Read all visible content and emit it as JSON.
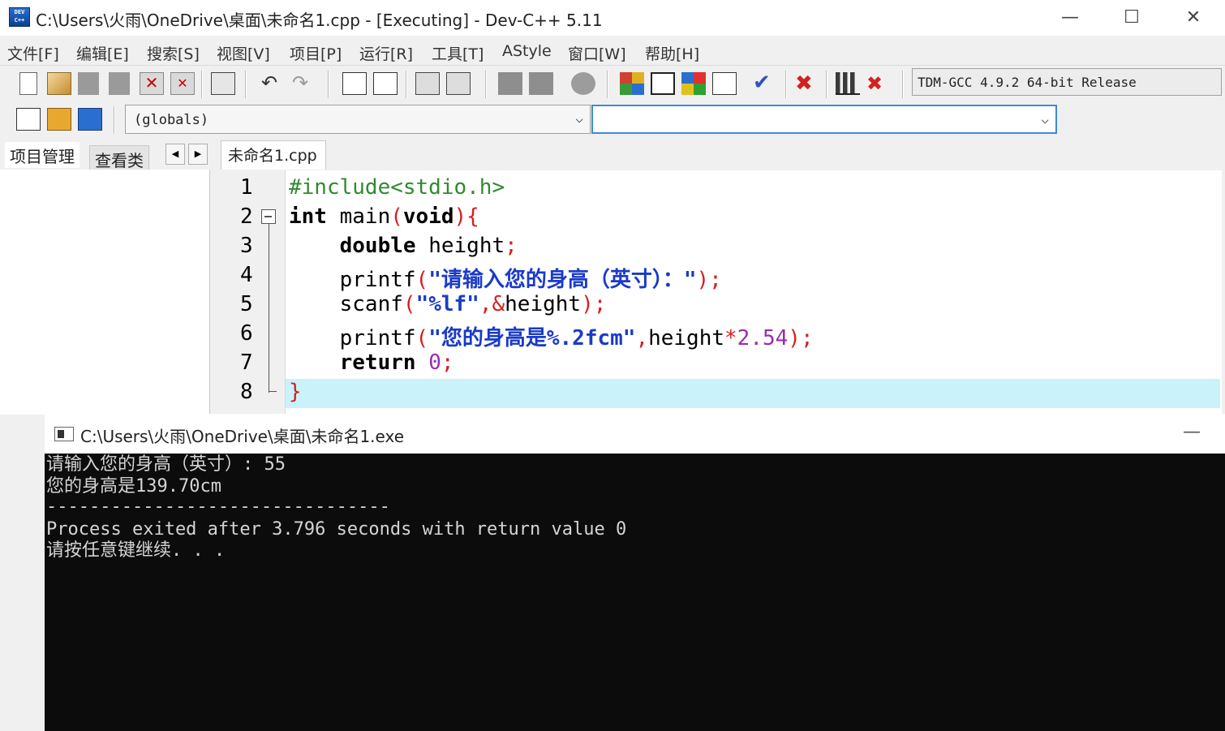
{
  "window": {
    "title": "C:\\Users\\火雨\\OneDrive\\桌面\\未命名1.cpp - [Executing] - Dev-C++ 5.11",
    "icon_label": "DEV C++",
    "min_glyph": "—",
    "max_glyph": "☐",
    "close_glyph": "✕"
  },
  "menu": [
    "文件[F]",
    "编辑[E]",
    "搜索[S]",
    "视图[V]",
    "项目[P]",
    "运行[R]",
    "工具[T]",
    "AStyle",
    "窗口[W]",
    "帮助[H]"
  ],
  "toolbar": {
    "icons": [
      "new-file-icon",
      "open-file-icon",
      "save-icon",
      "save-all-icon",
      "close-icon",
      "close-all-icon",
      "print-icon",
      "undo-icon",
      "redo-icon",
      "find-icon",
      "replace-icon",
      "indent-icon",
      "unindent-icon",
      "bookmark-prev-icon",
      "bookmark-next-icon",
      "toggle-comment-icon",
      "new-project-icon",
      "window-icon",
      "compile-icon",
      "run-icon",
      "check-icon",
      "stop-icon",
      "chart-icon",
      "debug-icon"
    ],
    "compiler": "TDM-GCC 4.9.2 64-bit Release"
  },
  "toolbar2": {
    "globals": "(globals)",
    "function_combo": ""
  },
  "left_panel": {
    "tabs": [
      "项目管理",
      "查看类"
    ],
    "nav_prev": "◀",
    "nav_next": "▶"
  },
  "editor": {
    "tab": "未命名1.cpp",
    "line_numbers": [
      "1",
      "2",
      "3",
      "4",
      "5",
      "6",
      "7",
      "8"
    ],
    "highlight_color": "#c9f2fa"
  },
  "console": {
    "title": "C:\\Users\\火雨\\OneDrive\\桌面\\未命名1.exe",
    "min_glyph": "—",
    "lines": [
      "请输入您的身高（英寸）: 55",
      "您的身高是139.70cm",
      "--------------------------------",
      "Process exited after 3.796 seconds with return value 0",
      "请按任意键继续. . ."
    ]
  },
  "code": {
    "l1_pp": "#include<stdio.h>",
    "l2_int": "int",
    "l2_main": " main",
    "l2_p1": "(",
    "l2_void": "void",
    "l2_p2": "){",
    "l3_double": "double",
    "l3_height": " height",
    "l3_semi": ";",
    "l4_printf": "printf",
    "l4_p1": "(",
    "l4_str": "\"请输入您的身高（英寸）：\"",
    "l4_p2": ");",
    "l5_scanf": "scanf",
    "l5_p1": "(",
    "l5_str": "\"%lf\"",
    "l5_comma": ",&",
    "l5_height": "height",
    "l5_p2": ");",
    "l6_printf": "printf",
    "l6_p1": "(",
    "l6_str": "\"您的身高是%.2fcm\"",
    "l6_comma": ",",
    "l6_height": "height",
    "l6_mul": "*",
    "l6_num": "2.54",
    "l6_p2": ");",
    "l7_return": "return",
    "l7_zero": "0",
    "l7_semi": ";",
    "l8_brace": "}"
  }
}
